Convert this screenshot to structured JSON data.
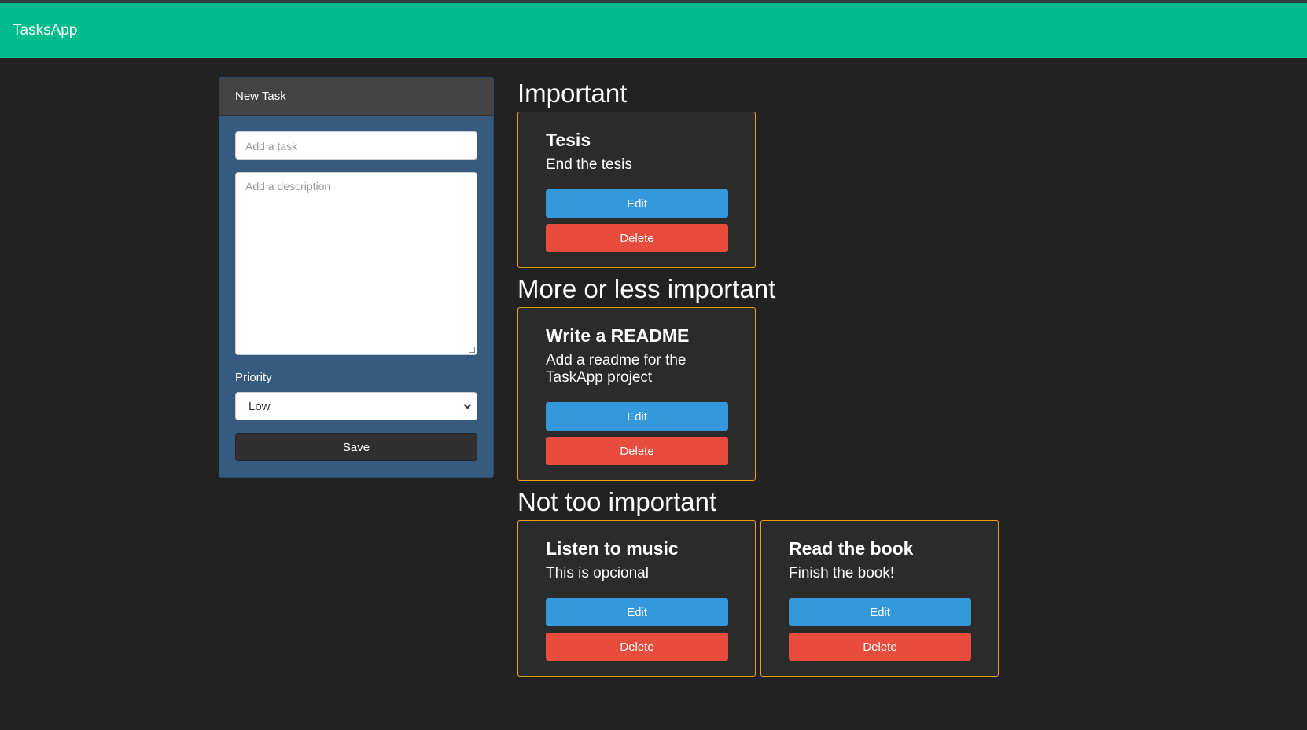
{
  "navbar": {
    "brand": "TasksApp"
  },
  "form": {
    "header": "New Task",
    "title_placeholder": "Add a task",
    "description_placeholder": "Add a description",
    "priority_label": "Priority",
    "priority_selected": "Low",
    "save_label": "Save"
  },
  "sections": [
    {
      "title": "Important",
      "cards": [
        {
          "title": "Tesis",
          "description": "End the tesis",
          "edit": "Edit",
          "delete": "Delete"
        }
      ]
    },
    {
      "title": "More or less important",
      "cards": [
        {
          "title": "Write a README",
          "description": "Add a readme for the TaskApp project",
          "edit": "Edit",
          "delete": "Delete"
        }
      ]
    },
    {
      "title": "Not too important",
      "cards": [
        {
          "title": "Listen to music",
          "description": "This is opcional",
          "edit": "Edit",
          "delete": "Delete"
        },
        {
          "title": "Read the book",
          "description": "Finish the book!",
          "edit": "Edit",
          "delete": "Delete"
        }
      ]
    }
  ],
  "colors": {
    "navbar": "#00bc8c",
    "background": "#222222",
    "form_panel": "#375a7f",
    "card_border": "#f39c12",
    "edit": "#3498db",
    "delete": "#e74c3c"
  }
}
